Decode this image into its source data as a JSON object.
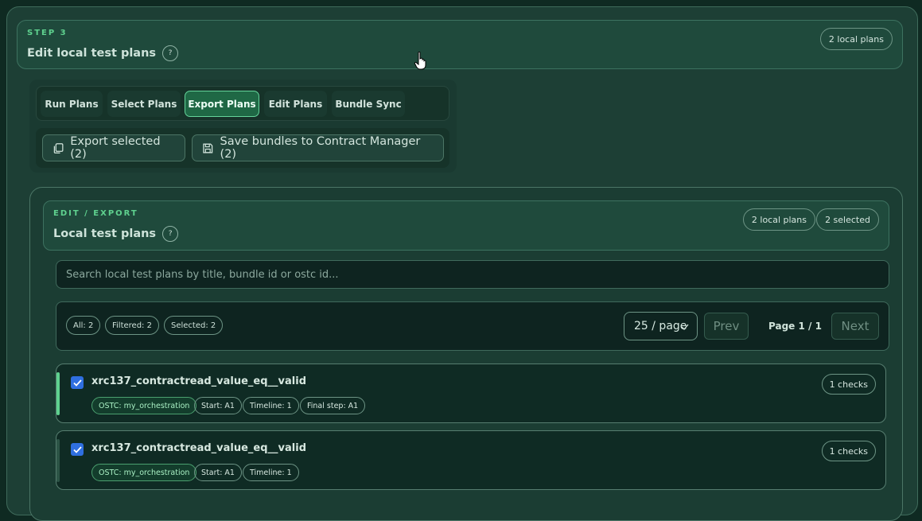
{
  "step": {
    "eyebrow": "STEP 3",
    "title": "Edit local test plans",
    "help": "?",
    "badge": "2 local plans"
  },
  "tabs": [
    {
      "label": "Run Plans",
      "active": false
    },
    {
      "label": "Select Plans",
      "active": false
    },
    {
      "label": "Export Plans",
      "active": true
    },
    {
      "label": "Edit Plans",
      "active": false
    },
    {
      "label": "Bundle Sync",
      "active": false
    }
  ],
  "actions": {
    "export_label": "Export selected (2)",
    "save_label": "Save bundles to Contract Manager (2)"
  },
  "edit": {
    "eyebrow": "EDIT / EXPORT",
    "title": "Local test plans",
    "help": "?",
    "badge_plans": "2 local plans",
    "badge_selected": "2 selected"
  },
  "search": {
    "placeholder": "Search local test plans by title, bundle id or ostc id..."
  },
  "filters": {
    "all": "All: 2",
    "filtered": "Filtered: 2",
    "selected": "Selected: 2"
  },
  "pagination": {
    "page_size": "25 / page",
    "prev": "Prev",
    "page_info": "Page 1 / 1",
    "next": "Next"
  },
  "plans": [
    {
      "title": "xrc137_contractread_value_eq__valid",
      "checked": true,
      "ostc": "OSTC: my_orchestration",
      "start": "Start: A1",
      "timeline": "Timeline: 1",
      "final_step": "Final step: A1",
      "checks": "1 checks"
    },
    {
      "title": "xrc137_contractread_value_eq__valid",
      "checked": true,
      "ostc": "OSTC: my_orchestration",
      "start": "Start: A1",
      "timeline": "Timeline: 1",
      "checks": "1 checks"
    }
  ],
  "colors": {
    "accent_green": "#5fd18f",
    "active_tab": "#1f6845",
    "checkbox_blue": "#2f6fe0"
  }
}
